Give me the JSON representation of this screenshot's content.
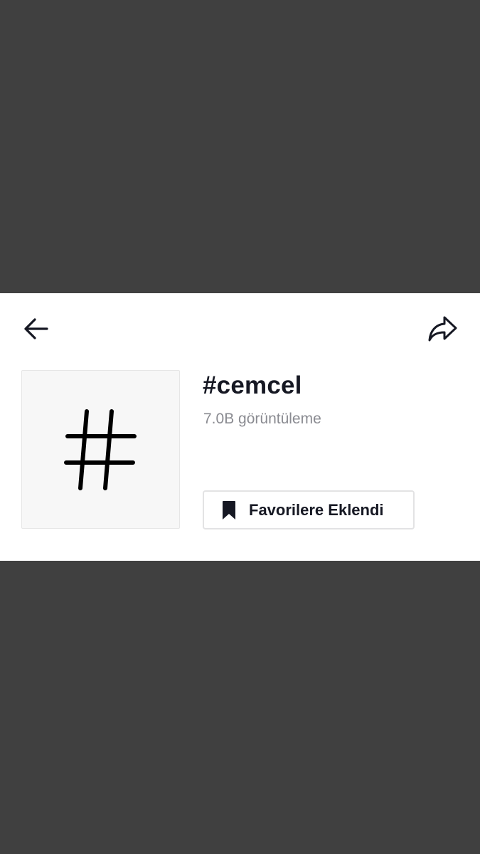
{
  "header": {
    "back_icon": "arrow-left-icon",
    "share_icon": "share-arrow-icon"
  },
  "hashtag": {
    "thumbnail_icon": "hashtag-icon",
    "title": "#cemcel",
    "views": "7.0B görüntüleme"
  },
  "favorite_button": {
    "icon": "bookmark-icon",
    "label": "Favorilere Eklendi"
  },
  "colors": {
    "backdrop": "#404040",
    "panel": "#ffffff",
    "text_primary": "#161823",
    "text_secondary": "#8a8b91",
    "thumb_bg": "#f7f7f7"
  }
}
